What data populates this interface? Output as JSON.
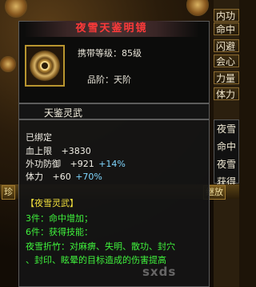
{
  "side_stats": [
    "内功",
    "命中",
    "闪避",
    "会心",
    "力量",
    "体力"
  ],
  "side_tip": [
    "夜雪",
    "命中",
    "夜雪",
    "获得"
  ],
  "bottom_bar": {
    "left_label": "珍",
    "right_label": "继放"
  },
  "tooltip": {
    "title": "夜雪天鉴明镜",
    "icon": "mirror-artifact-icon",
    "carry_level": "携带等级：85级",
    "grade": "品阶：天阶",
    "item_name": "天鉴灵武",
    "bound": "已绑定",
    "stats": [
      {
        "label": "血上限",
        "base": "+3830",
        "extra": ""
      },
      {
        "label": "外功防御",
        "base": "+921",
        "extra": "+14%"
      },
      {
        "label": "体力",
        "base": "+60",
        "extra": "+70%"
      }
    ],
    "set_title": "【夜雪灵武】",
    "set_lines": [
      "3件：命中增加；",
      "6件：获得技能：",
      "夜雪折竹：对麻痹、失明、散功、封穴",
      "、封印、眩晕的目标造成的伤害提高"
    ]
  },
  "watermark": "sxds",
  "colors": {
    "title": "#ff3a3a",
    "stat_extra": "#7fd7ff",
    "set_title": "#f2df3c",
    "set_text": "#3ff23c"
  }
}
